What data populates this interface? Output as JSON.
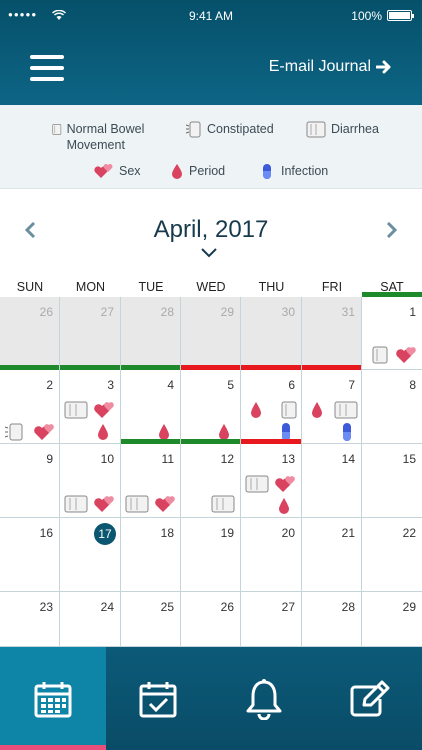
{
  "status_bar": {
    "signal": "●●●●●",
    "time": "9:41 AM",
    "battery": "100%"
  },
  "header": {
    "email_label": "E-mail Journal"
  },
  "legend": {
    "normal": "Normal Bowel Movement",
    "constipated": "Constipated",
    "diarrhea": "Diarrhea",
    "sex": "Sex",
    "period": "Period",
    "infection": "Infection"
  },
  "calendar": {
    "month_label": "April, 2017",
    "weekdays": [
      "SUN",
      "MON",
      "TUE",
      "WED",
      "THU",
      "FRI",
      "SAT"
    ],
    "days": [
      "26",
      "27",
      "28",
      "29",
      "30",
      "31",
      "1",
      "2",
      "3",
      "4",
      "5",
      "6",
      "7",
      "8",
      "9",
      "10",
      "11",
      "12",
      "13",
      "14",
      "15",
      "16",
      "17",
      "18",
      "19",
      "20",
      "21",
      "22",
      "23",
      "24",
      "25",
      "26",
      "27",
      "28",
      "29"
    ],
    "today": "17"
  },
  "colors": {
    "accent": "#0b5670",
    "good": "#1f8a2c",
    "bad": "#e8191e",
    "period": "#d9435f",
    "tab_active": "#0e85a6",
    "tab_indicator": "#e84f7a"
  },
  "tabbar": {
    "tabs": [
      "calendar-icon",
      "calendar-check-icon",
      "bell-icon",
      "edit-icon"
    ]
  }
}
